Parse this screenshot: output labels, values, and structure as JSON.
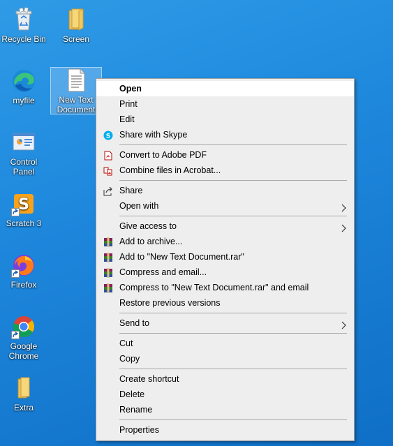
{
  "desktop": {
    "icons": [
      {
        "label": "Recycle Bin"
      },
      {
        "label": "Screen"
      },
      {
        "label": "myfile"
      },
      {
        "label": "New Text Document"
      },
      {
        "label": "Control Panel"
      },
      {
        "label": "Scratch 3"
      },
      {
        "label": "Firefox"
      },
      {
        "label": "Google Chrome"
      },
      {
        "label": "Extra"
      }
    ]
  },
  "context_menu": {
    "open": "Open",
    "print": "Print",
    "edit": "Edit",
    "share_skype": "Share with Skype",
    "convert_pdf": "Convert to Adobe PDF",
    "combine_acrobat": "Combine files in Acrobat...",
    "share": "Share",
    "open_with": "Open with",
    "give_access": "Give access to",
    "add_archive": "Add to archive...",
    "add_rar": "Add to \"New Text Document.rar\"",
    "compress_email": "Compress and email...",
    "compress_rar_email": "Compress to \"New Text Document.rar\" and email",
    "restore_versions": "Restore previous versions",
    "send_to": "Send to",
    "cut": "Cut",
    "copy": "Copy",
    "create_shortcut": "Create shortcut",
    "delete": "Delete",
    "rename": "Rename",
    "properties": "Properties"
  },
  "colors": {
    "desktop_bg": "#1e88dd",
    "menu_bg": "#eeeeee",
    "menu_highlight": "#ffffff"
  }
}
